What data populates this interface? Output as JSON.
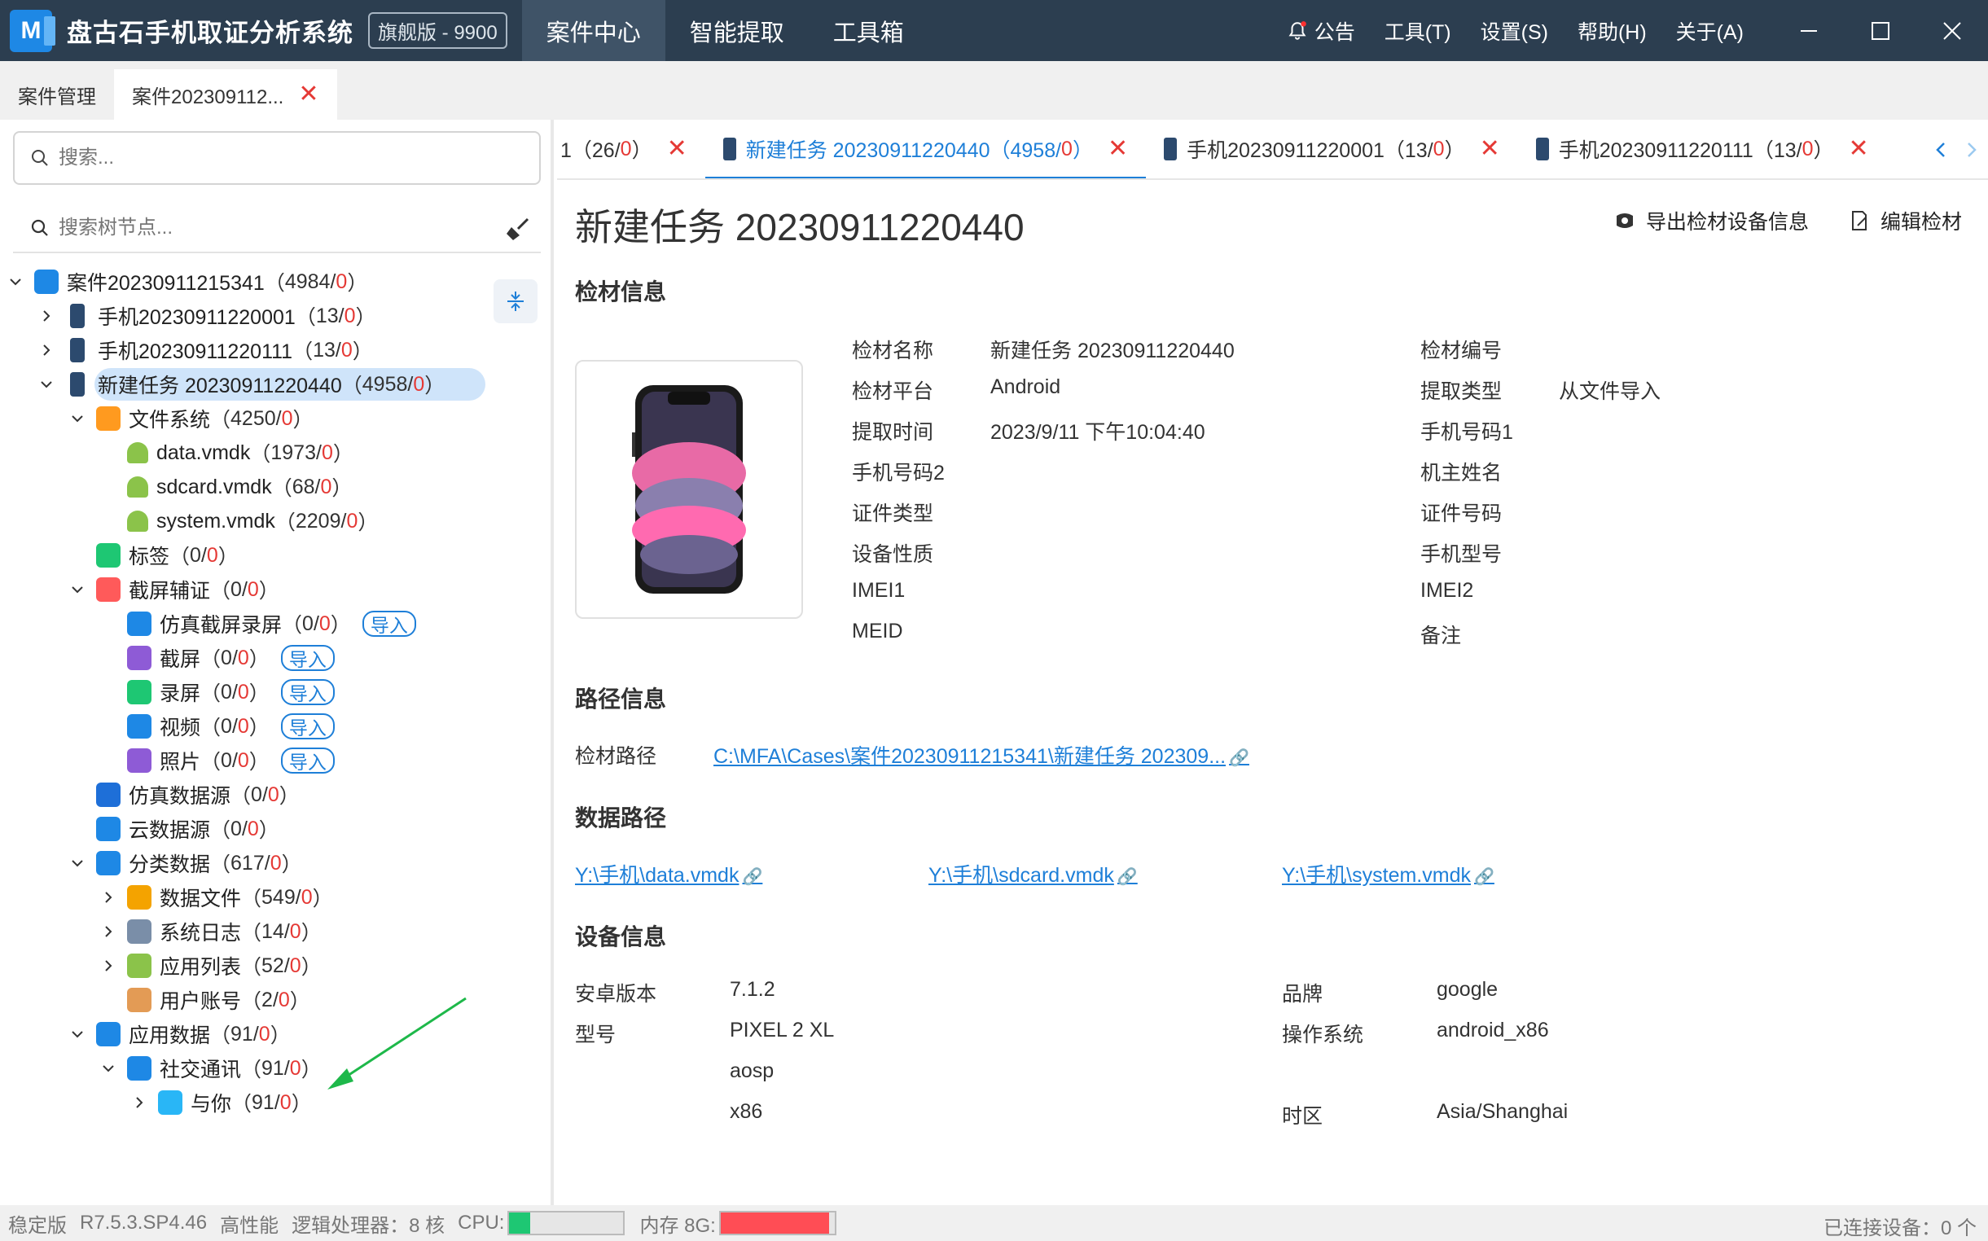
{
  "titlebar": {
    "logo_letter": "M",
    "app_title": "盘古石手机取证分析系统",
    "edition": "旗舰版 - 9900",
    "nav": [
      "案件中心",
      "智能提取",
      "工具箱"
    ],
    "active_nav": 0,
    "menu": [
      "公告",
      "工具(T)",
      "设置(S)",
      "帮助(H)",
      "关于(A)"
    ]
  },
  "case_tabs": [
    {
      "label": "案件管理"
    },
    {
      "label": "案件202309112..."
    }
  ],
  "left": {
    "search_placeholder": "搜索...",
    "tree_search_placeholder": "搜索树节点...",
    "tree": [
      {
        "label": "案件20230911215341",
        "count": "4984",
        "zero": "0",
        "level": 0,
        "caret": "down",
        "icon": "case-icon",
        "color": "#1e88e5"
      },
      {
        "label": "手机20230911220001",
        "count": "13",
        "zero": "0",
        "level": 1,
        "caret": "right",
        "icon": "phone-icon",
        "color": "#2c4a6e"
      },
      {
        "label": "手机20230911220111",
        "count": "13",
        "zero": "0",
        "level": 1,
        "caret": "right",
        "icon": "phone-icon",
        "color": "#2c4a6e"
      },
      {
        "label": "新建任务 20230911220440",
        "count": "4958",
        "zero": "0",
        "level": 1,
        "caret": "down",
        "icon": "phone-icon",
        "color": "#2c4a6e",
        "selected": true
      },
      {
        "label": "文件系统",
        "count": "4250",
        "zero": "0",
        "level": 2,
        "caret": "down",
        "icon": "folder-icon",
        "color": "#ff9a1f"
      },
      {
        "label": "data.vmdk",
        "count": "1973",
        "zero": "0",
        "level": 3,
        "caret": "none",
        "icon": "android-icon",
        "color": "#8bc34a"
      },
      {
        "label": "sdcard.vmdk",
        "count": "68",
        "zero": "0",
        "level": 3,
        "caret": "none",
        "icon": "android-icon",
        "color": "#8bc34a"
      },
      {
        "label": "system.vmdk",
        "count": "2209",
        "zero": "0",
        "level": 3,
        "caret": "none",
        "icon": "android-icon",
        "color": "#8bc34a"
      },
      {
        "label": "标签",
        "count": "0",
        "zero": "0",
        "level": 2,
        "caret": "none",
        "icon": "tag-icon",
        "color": "#1ec773"
      },
      {
        "label": "截屏辅证",
        "count": "0",
        "zero": "0",
        "level": 2,
        "caret": "down",
        "icon": "camera-icon",
        "color": "#ff5a5a"
      },
      {
        "label": "仿真截屏录屏",
        "count": "0",
        "zero": "0",
        "level": 3,
        "caret": "none",
        "icon": "emulator-icon",
        "color": "#1e88e5",
        "import": "导入"
      },
      {
        "label": "截屏",
        "count": "0",
        "zero": "0",
        "level": 3,
        "caret": "none",
        "icon": "screenshot-icon",
        "color": "#8e5bd6",
        "import": "导入"
      },
      {
        "label": "录屏",
        "count": "0",
        "zero": "0",
        "level": 3,
        "caret": "none",
        "icon": "record-icon",
        "color": "#1ec773",
        "import": "导入"
      },
      {
        "label": "视频",
        "count": "0",
        "zero": "0",
        "level": 3,
        "caret": "none",
        "icon": "video-icon",
        "color": "#1e88e5",
        "import": "导入"
      },
      {
        "label": "照片",
        "count": "0",
        "zero": "0",
        "level": 3,
        "caret": "none",
        "icon": "photo-icon",
        "color": "#8e5bd6",
        "import": "导入"
      },
      {
        "label": "仿真数据源",
        "count": "0",
        "zero": "0",
        "level": 2,
        "caret": "none",
        "icon": "emulator-source-icon",
        "color": "#1e6fd8"
      },
      {
        "label": "云数据源",
        "count": "0",
        "zero": "0",
        "level": 2,
        "caret": "none",
        "icon": "cloud-icon",
        "color": "#1e88e5"
      },
      {
        "label": "分类数据",
        "count": "617",
        "zero": "0",
        "level": 2,
        "caret": "down",
        "icon": "category-icon",
        "color": "#1e88e5"
      },
      {
        "label": "数据文件",
        "count": "549",
        "zero": "0",
        "level": 3,
        "caret": "right",
        "icon": "data-file-icon",
        "color": "#f4a300"
      },
      {
        "label": "系统日志",
        "count": "14",
        "zero": "0",
        "level": 3,
        "caret": "right",
        "icon": "system-log-icon",
        "color": "#7a8ea8"
      },
      {
        "label": "应用列表",
        "count": "52",
        "zero": "0",
        "level": 3,
        "caret": "right",
        "icon": "app-list-icon",
        "color": "#8bc34a"
      },
      {
        "label": "用户账号",
        "count": "2",
        "zero": "0",
        "level": 3,
        "caret": "none",
        "icon": "user-account-icon",
        "color": "#e39b55"
      },
      {
        "label": "应用数据",
        "count": "91",
        "zero": "0",
        "level": 2,
        "caret": "down",
        "icon": "app-data-icon",
        "color": "#1e88e5"
      },
      {
        "label": "社交通讯",
        "count": "91",
        "zero": "0",
        "level": 3,
        "caret": "down",
        "icon": "chat-icon",
        "color": "#1e88e5"
      },
      {
        "label": "与你",
        "count": "91",
        "zero": "0",
        "level": 4,
        "caret": "right",
        "icon": "yuni-app-icon",
        "color": "#29b6f6"
      }
    ]
  },
  "task_tabs": [
    {
      "label": "1（26/",
      "zero": "0",
      "suffix": "）",
      "phone": false
    },
    {
      "label": "新建任务 20230911220440（4958/",
      "zero": "0",
      "suffix": "）",
      "phone": true,
      "active": true
    },
    {
      "label": "手机20230911220001（13/",
      "zero": "0",
      "suffix": "）",
      "phone": true
    },
    {
      "label": "手机20230911220111（13/",
      "zero": "0",
      "suffix": "）",
      "phone": true
    }
  ],
  "main": {
    "title": "新建任务 20230911220440",
    "actions": [
      "导出检材设备信息",
      "编辑检材"
    ],
    "sections": {
      "evidence": "检材信息",
      "path": "路径信息",
      "data_path": "数据路径",
      "device": "设备信息"
    },
    "evidence_left": [
      {
        "k": "检材名称",
        "v": "新建任务 20230911220440"
      },
      {
        "k": "检材平台",
        "v": "Android"
      },
      {
        "k": "提取时间",
        "v": "2023/9/11 下午10:04:40"
      },
      {
        "k": "手机号码2",
        "v": ""
      },
      {
        "k": "证件类型",
        "v": ""
      },
      {
        "k": "设备性质",
        "v": ""
      },
      {
        "k": "IMEI1",
        "v": ""
      },
      {
        "k": "MEID",
        "v": ""
      }
    ],
    "evidence_right": [
      {
        "k": "检材编号",
        "v": ""
      },
      {
        "k": "提取类型",
        "v": "从文件导入"
      },
      {
        "k": "手机号码1",
        "v": ""
      },
      {
        "k": "机主姓名",
        "v": ""
      },
      {
        "k": "证件号码",
        "v": ""
      },
      {
        "k": "手机型号",
        "v": ""
      },
      {
        "k": "IMEI2",
        "v": ""
      },
      {
        "k": "备注",
        "v": ""
      }
    ],
    "path_label": "检材路径",
    "path_value": "C:\\MFA\\Cases\\案件20230911215341\\新建任务 202309...",
    "data_paths": [
      "Y:\\手机\\data.vmdk",
      "Y:\\手机\\sdcard.vmdk",
      "Y:\\手机\\system.vmdk"
    ],
    "device_left": [
      {
        "k": "安卓版本",
        "v": "7.1.2"
      },
      {
        "k": "型号",
        "v": "PIXEL 2 XL"
      },
      {
        "k": "",
        "v": "aosp"
      },
      {
        "k": "",
        "v": "x86"
      }
    ],
    "device_right": [
      {
        "k": "品牌",
        "v": "google"
      },
      {
        "k": "操作系统",
        "v": "android_x86"
      },
      {
        "k": "",
        "v": ""
      },
      {
        "k": "时区",
        "v": "Asia/Shanghai"
      }
    ]
  },
  "status": {
    "edition": "稳定版",
    "version": "R7.5.3.SP4.46",
    "perf": "高性能",
    "cpu_label": "逻辑处理器：8 核",
    "cpu_text": "CPU:",
    "cpu_usage": 0.18,
    "mem_label": "内存 8G:",
    "mem_usage": 0.95,
    "devices": "已连接设备：0 个"
  },
  "colors": {
    "titlebar": "#2c3e50",
    "accent": "#1e7fd8",
    "zero_count": "#e53935",
    "selected_row": "#cfe4fa",
    "annotation_arrow": "#1eb84a"
  }
}
